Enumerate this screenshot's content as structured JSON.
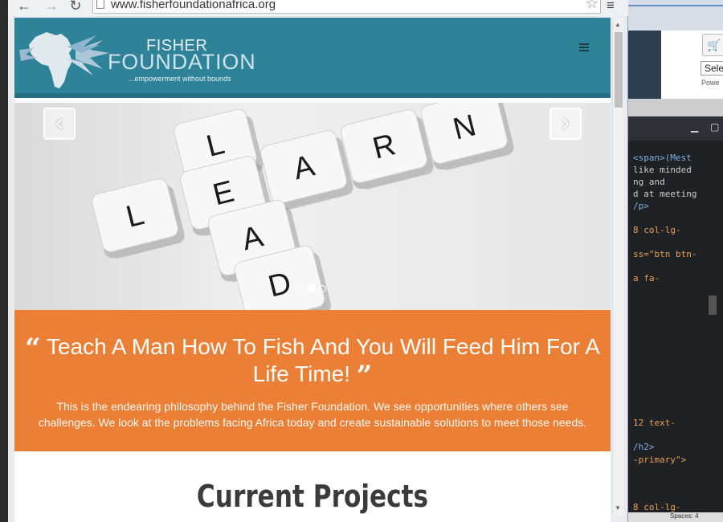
{
  "browser": {
    "url": "www.fisherfoundationafrica.org"
  },
  "site": {
    "brand_line1": "FISHER",
    "brand_line2": "FOUNDATION",
    "tagline": "...empowerment without bounds"
  },
  "hero": {
    "prev_glyph": "‹",
    "next_glyph": "›",
    "tiles_horizontal": [
      "L",
      "E",
      "A",
      "R",
      "N"
    ],
    "tiles_vertical": [
      "L",
      "E",
      "A",
      "D"
    ],
    "slide_count": 3,
    "active_slide": 2
  },
  "quote": {
    "open_mark": "“",
    "heading": "Teach A Man How To Fish And You Will Feed Him For A Life Time!",
    "close_mark": "”",
    "body": "This is the endearing philosophy behind the Fisher Foundation. We see opportunities where others see challenges. We look at the problems facing Africa today and create sustainable solutions to meet those needs."
  },
  "projects": {
    "heading": "Current Projects"
  },
  "background_app": {
    "select_text": "Sele",
    "power_text": "Powe",
    "status_text": "Spaces: 4",
    "code_lines": [
      {
        "text": "<span>(Mest",
        "cls": "b"
      },
      {
        "text": " like minded",
        "cls": ""
      },
      {
        "text": "ng and",
        "cls": ""
      },
      {
        "text": "d at meeting",
        "cls": ""
      },
      {
        "text": "/p>",
        "cls": "b"
      },
      {
        "text": "8 col-lg-",
        "cls": "o"
      },
      {
        "text": "ss=\"btn btn-",
        "cls": "s"
      },
      {
        "text": "a fa-",
        "cls": "o"
      },
      {
        "text": "12 text-",
        "cls": "o"
      },
      {
        "text": "/h2>",
        "cls": "b"
      },
      {
        "text": "-primary\">",
        "cls": "s"
      },
      {
        "text": "8 col-lg-",
        "cls": "o"
      }
    ]
  },
  "colors": {
    "header": "#2e8399",
    "accent_orange": "#ec7f36",
    "heading_gray": "#3b3b3b"
  }
}
